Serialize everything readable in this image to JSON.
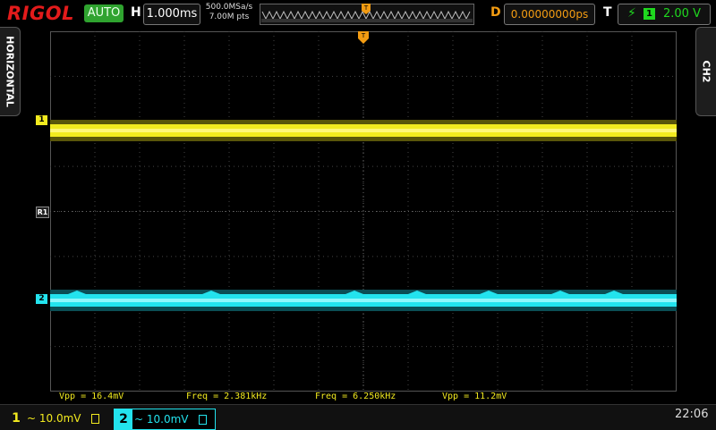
{
  "header": {
    "logo": "RIGOL",
    "run_status": "AUTO",
    "horizontal_label": "H",
    "timebase": "1.000ms",
    "sample_rate": "500.0MSa/s",
    "memory_depth": "7.00M pts",
    "delay_label": "D",
    "delay_value": "0.00000000ps",
    "trigger_label": "T",
    "trigger_source": "1",
    "trigger_level": "2.00 V"
  },
  "side_tabs": {
    "left": "HORIZONTAL",
    "right": "CH2"
  },
  "markers": {
    "ch1": "1",
    "ch2": "2",
    "ref": "R1",
    "trigger_pos": "T"
  },
  "measurements": [
    {
      "text": "Vpp = 16.4mV"
    },
    {
      "text": "Freq = 2.381kHz"
    },
    {
      "text": "Freq = 6.250kHz"
    },
    {
      "text": "Vpp = 11.2mV"
    }
  ],
  "channels": [
    {
      "number": "1",
      "value": "~ 10.0mV",
      "color": "#f2ea1f"
    },
    {
      "number": "2",
      "value": "~ 10.0mV",
      "color": "#23e3ee"
    }
  ],
  "clock": "22:06",
  "icons": {
    "trigger_edge": "rising-edge-icon",
    "trigger_position": "trigger-position-icon",
    "memory": "memory-waveform-icon"
  }
}
